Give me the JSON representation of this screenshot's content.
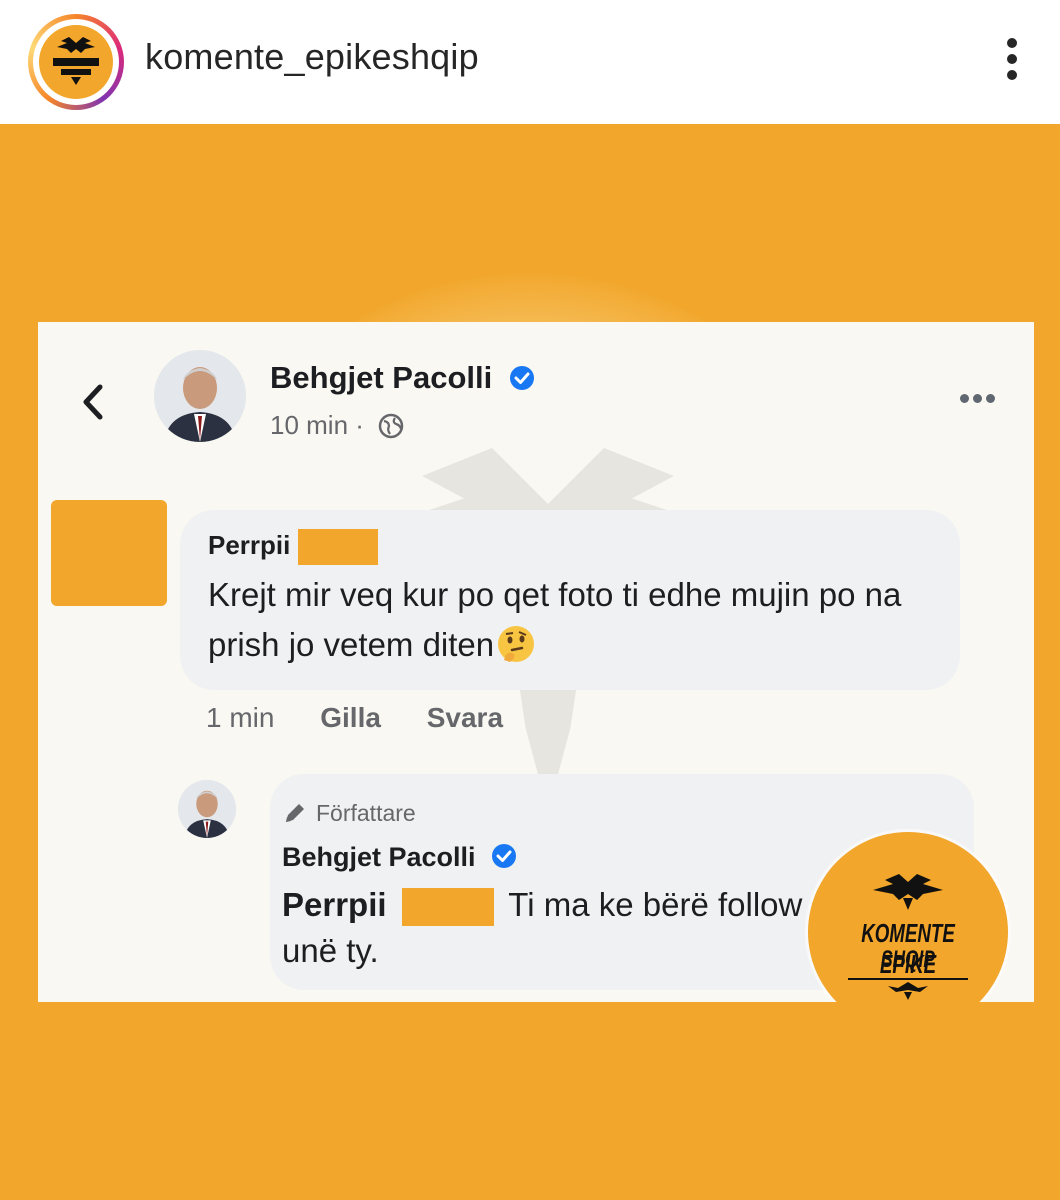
{
  "instagram": {
    "username": "komente_epikeshqip",
    "avatar_icon": "eagle-logo-icon",
    "more_icon": "vertical-dots-icon"
  },
  "post": {
    "header": {
      "author": "Behgjet Pacolli",
      "time": "10 min ·",
      "verified_icon": "verified-badge-icon",
      "privacy_icon": "globe-icon"
    },
    "comment": {
      "author": "Perrpii",
      "text": "Krejt mir veq kur po qet foto ti edhe mujin po na prish jo vetem diten",
      "emoji": "thinking-face",
      "time": "1 min",
      "like_label": "Gilla",
      "reply_label": "Svara"
    },
    "reply": {
      "badge": "Författare",
      "author": "Behgjet Pacolli",
      "mention": "Perrpii",
      "text": "Ti ma ke bërë follow mua, jo unë ty."
    },
    "stamp": {
      "line1": "KOMENTE EPIKE",
      "line2": "SHQIP"
    }
  },
  "colors": {
    "brand_orange": "#f2a62b",
    "facebook_blue": "#1877f2"
  }
}
